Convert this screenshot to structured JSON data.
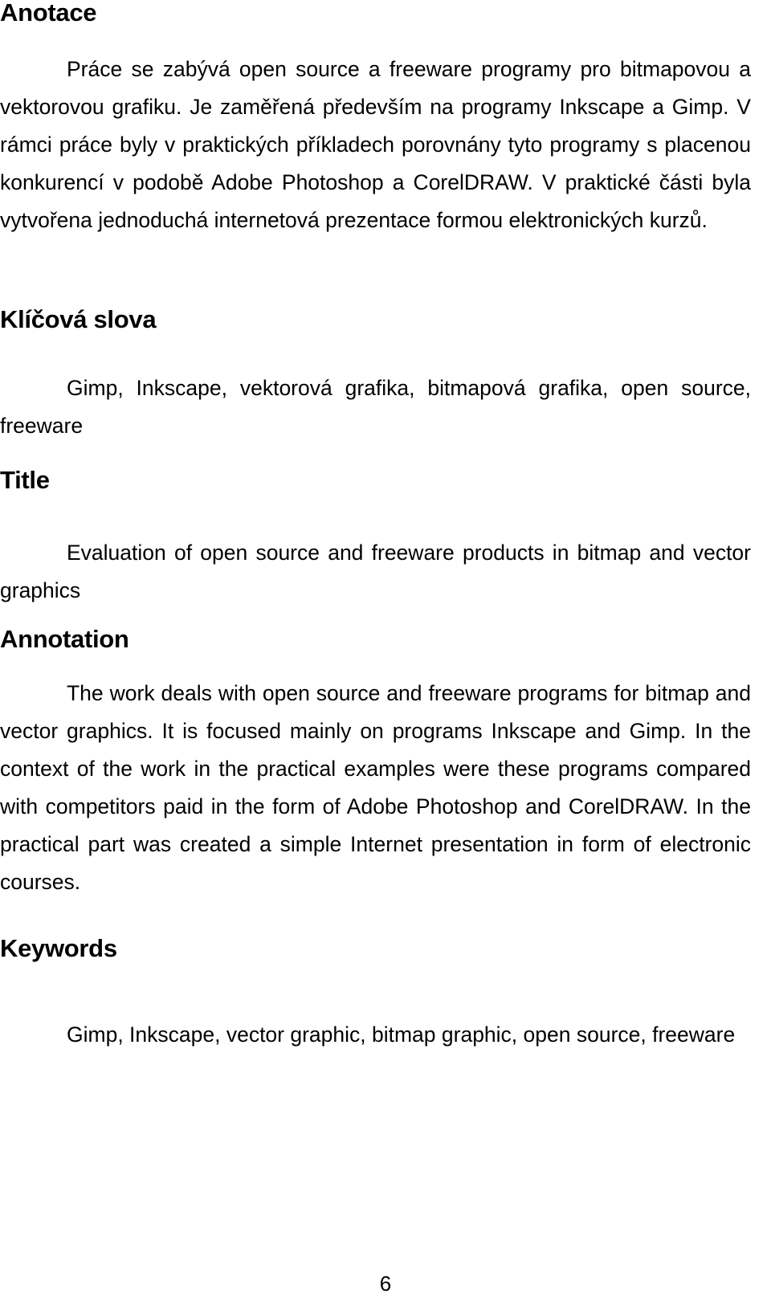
{
  "page": {
    "number": "6",
    "language_primary": "cs",
    "language_secondary": "en"
  },
  "sections": {
    "anotace": {
      "heading": "Anotace",
      "body": "Práce se zabývá open source a freeware programy pro bitmapovou a vektorovou grafiku. Je zaměřená především na programy Inkscape a Gimp. V rámci práce byly v praktických příkladech porovnány tyto programy s placenou konkurencí v podobě Adobe Photoshop a CorelDRAW. V praktické části byla vytvořena jednoduchá internetová prezentace formou elektronických kurzů."
    },
    "klicova_slova": {
      "heading": "Klíčová slova",
      "body": "Gimp, Inkscape, vektorová grafika, bitmapová grafika, open source, freeware"
    },
    "title": {
      "heading": "Title",
      "body": "Evaluation of open source and freeware products in bitmap and vector graphics"
    },
    "annotation": {
      "heading": "Annotation",
      "body": "The work deals with open source and freeware programs for bitmap and vector graphics. It is focused mainly on programs Inkscape and Gimp. In the context of the work in the practical examples were these programs compared with competitors paid in the form of Adobe Photoshop and CorelDRAW. In the practical part was created a simple Internet presentation in form of electronic courses."
    },
    "keywords": {
      "heading": "Keywords",
      "body": "Gimp, Inkscape, vector graphic, bitmap graphic, open source, freeware"
    }
  },
  "colors": {
    "page_background": "#ffffff",
    "text": "#000000"
  }
}
